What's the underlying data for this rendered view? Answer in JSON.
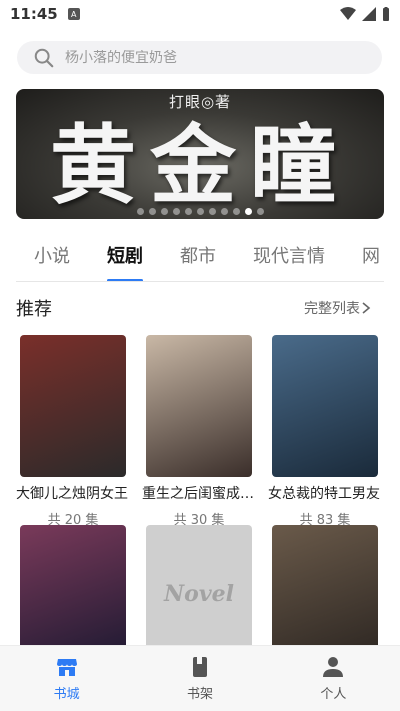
{
  "status_bar": {
    "time": "11:45"
  },
  "search": {
    "placeholder": "杨小落的便宜奶爸"
  },
  "banner": {
    "author": "打眼◎著",
    "title": "黄金瞳",
    "slide_count": 11,
    "active_slide": 9
  },
  "tabs": [
    {
      "label": "小说",
      "active": false
    },
    {
      "label": "短剧",
      "active": true
    },
    {
      "label": "都市",
      "active": false
    },
    {
      "label": "现代言情",
      "active": false
    },
    {
      "label": "网",
      "active": false
    }
  ],
  "section": {
    "title": "推荐",
    "more_label": "完整列表"
  },
  "items": [
    {
      "title": "大御儿之烛阴女王",
      "count": "共 20 集",
      "colors": [
        "#2b2a2a",
        "#7a2f2a"
      ]
    },
    {
      "title": "重生之后闺蜜成功接盘我老公",
      "count": "共 30 集",
      "colors": [
        "#3a2e2a",
        "#c9b8a6"
      ]
    },
    {
      "title": "女总裁的特工男友",
      "count": "共 83 集",
      "colors": [
        "#1a2a3a",
        "#4a6b8a"
      ]
    },
    {
      "title": "",
      "count": "",
      "colors": [
        "#1a1830",
        "#7a3a5a"
      ]
    },
    {
      "title": "",
      "count": "",
      "cover_text": "Novel",
      "colors": [
        "#cfcfcf",
        "#cfcfcf"
      ]
    },
    {
      "title": "",
      "count": "",
      "colors": [
        "#2a2420",
        "#6a5a4a"
      ]
    }
  ],
  "bottom_nav": [
    {
      "label": "书城",
      "icon": "store-icon",
      "active": true
    },
    {
      "label": "书架",
      "icon": "bookshelf-icon",
      "active": false
    },
    {
      "label": "个人",
      "icon": "person-icon",
      "active": false
    }
  ],
  "colors": {
    "accent": "#2d7bf4",
    "nav_inactive": "#555555"
  }
}
